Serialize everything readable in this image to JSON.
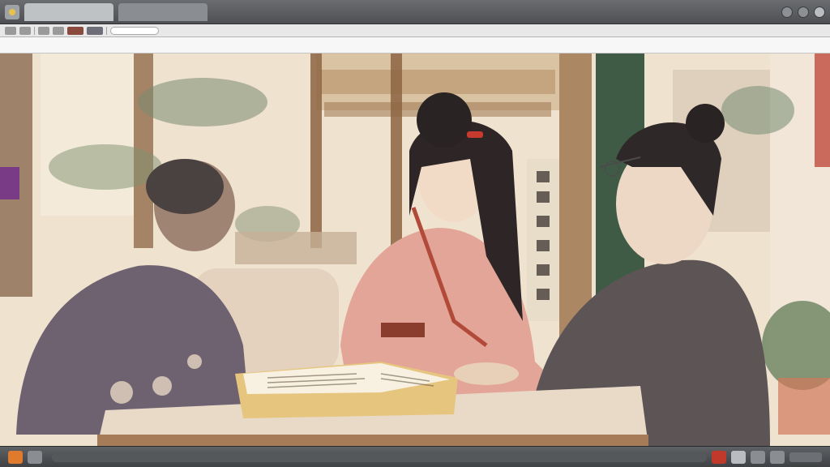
{
  "titlebar": {
    "tabs": [
      {
        "label": ""
      },
      {
        "label": ""
      }
    ],
    "title": ""
  },
  "address": {
    "text": ""
  },
  "taskbar": {
    "label": ""
  },
  "colors": {
    "titlebar": "#56585b",
    "toolbar": "#e8e8e8",
    "canvas_bg": "#efe3d1",
    "taskbar": "#4a4c4f",
    "accent_orange": "#e07a2c",
    "accent_red": "#c0392b"
  },
  "icons": {
    "app": "app-icon",
    "window_controls": [
      "minimize-icon",
      "maximize-icon",
      "close-icon"
    ]
  }
}
